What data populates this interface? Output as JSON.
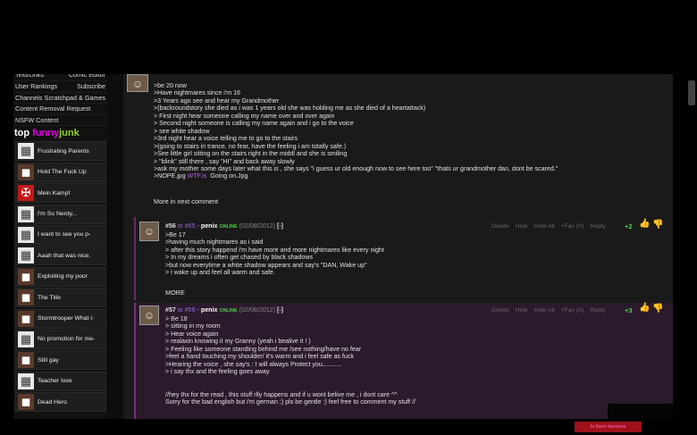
{
  "sidebar": {
    "nav_rows": [
      {
        "left": "Text/Links",
        "right": "Comic Editor",
        "partial": true
      },
      {
        "left": "User Rankings",
        "right": "Subscribe"
      },
      {
        "left": "Channels",
        "right": "Scratchpad & Games"
      },
      {
        "left": "Content Removal Request",
        "right": ""
      },
      {
        "left": "NSFW Content",
        "right": ""
      }
    ],
    "top_title": {
      "word1": "top ",
      "word2": "funny",
      "word3": "junk"
    },
    "top_items": [
      {
        "label": "Frustrating Parents",
        "icon": "comic-thumb-icon"
      },
      {
        "label": "Hold The Fuck Up",
        "icon": "photo-thumb-icon"
      },
      {
        "label": "Mein Kampf",
        "icon": "swastika-thumb-icon"
      },
      {
        "label": "I'm So Nerdy...",
        "icon": "comic-thumb-icon"
      },
      {
        "label": "I want to see you p-",
        "icon": "comic-thumb-icon"
      },
      {
        "label": "Aaah that was nice.",
        "icon": "comic-thumb-icon"
      },
      {
        "label": "Exploiting my poor",
        "icon": "photo-thumb-icon"
      },
      {
        "label": "The Title",
        "icon": "photo-thumb-icon"
      },
      {
        "label": "Stormtrooper What I-",
        "icon": "photo-thumb-icon"
      },
      {
        "label": "No promotion for me-",
        "icon": "comic-thumb-icon"
      },
      {
        "label": "Still gay",
        "icon": "photo-thumb-icon"
      },
      {
        "label": "Teacher love",
        "icon": "comic-thumb-icon"
      },
      {
        "label": "Dead Hero",
        "icon": "photo-thumb-icon"
      }
    ]
  },
  "comment_55": {
    "lines": [
      ">be 20 now",
      ">Have nightmares since i'm 16",
      ">3 Years ago see and hear my Grandmother",
      ">(backroundstory she died as i was 1 years old she was holding me as she died of a heartattack)",
      "> First night hear someone calling my name over and over again",
      "> Second night someone is calling my name again and i go to the voice",
      "> see white shadow",
      ">3rd night hear a voice telling me to go to the stairs",
      ">(going to stairs in trance, no fear, have the feeling i am totally safe.)",
      ">See little girl sitting on the stairs right in the middl and she is smiling",
      "> \"blink\" still there , say \"HI\" and back away slowly",
      ">ask my mother some days later what this is , she says \"i guess ur old enough now to see here too\" \"thats ur grandmother dan, dont be scared.\""
    ],
    "last_line_prefix": ">NOPE.jpg ",
    "last_line_link": "WTF.is",
    "last_line_suffix": "  Going on.Jpg",
    "more_label": "More in next comment"
  },
  "comment_56": {
    "number": "#56",
    "to_label": " to ",
    "to_target": "#55",
    "separator": " - ",
    "username": "penix",
    "online_label": "ONLINE",
    "date": "(02/08/2012)",
    "collapse": "[-]",
    "actions": [
      "Delete",
      "Hide",
      "Hide All",
      "+Fav (0)",
      "Reply"
    ],
    "score": "+2",
    "lines": [
      ">Be 17",
      ">having much nightmares as i said",
      "> after this story happend i'm have more and more nightmares like every night",
      "> In my dreams i often get chased by black shadows",
      ">but now everytime a white shadow appears and say's \"DAN, Wake up\"",
      "> i wake up and feel all warm and safe."
    ],
    "more_label": "MORE"
  },
  "comment_57": {
    "number": "#57",
    "to_label": " to ",
    "to_target": "#56",
    "separator": " - ",
    "username": "penix",
    "online_label": "ONLINE",
    "date": "(02/08/2012)",
    "collapse": "[-]",
    "actions": [
      "Delete",
      "Hide",
      "Hide All",
      "+Fav (0)",
      "Reply"
    ],
    "score": "+3",
    "lines": [
      "> Be 18",
      "> sitting in my room",
      "> Hear voice again",
      "> realaxin knowing it my Granny (yeah i bealive it ! )",
      "> Feeling like someone standing behind me /see nothing/have no fear",
      ">feel a hand touching my shoulder/ it's warm and i feel safe as fuck",
      ">Hearing the voice , she say's : I will always Protect you...........",
      "> i say thx and the feeling goes away",
      "",
      "",
      "//hey thx for the read , this stuff rlly happens and if u wont belive me , i dont care ^^",
      "Sorry for the bad english but i'm german ;) pls be gentle :) feel free to comment my stuff //"
    ]
  },
  "footer": {
    "red_label": "hi there banners"
  },
  "colors": {
    "accent_purple": "#b85fe0",
    "online_green": "#48d048",
    "score_green": "#4cd84c",
    "funny_magenta": "#e000e0",
    "junk_green": "#8fd12b"
  }
}
